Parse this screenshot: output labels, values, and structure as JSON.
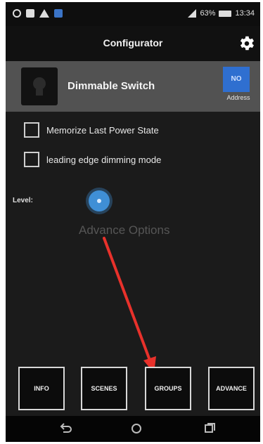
{
  "status_bar": {
    "battery": "63%",
    "time": "13:34",
    "icons": [
      "whatsapp-icon",
      "message-icon",
      "warning-icon",
      "store-icon",
      "signal-icon",
      "battery-icon"
    ]
  },
  "header": {
    "title": "Configurator",
    "settings_icon": "gear-icon"
  },
  "device": {
    "name": "Dimmable Switch",
    "address_badge": "NO",
    "address_label": "Address",
    "accent_color": "#2f6fd0"
  },
  "options": [
    {
      "label": "Memorize Last Power State",
      "checked": false
    },
    {
      "label": "leading edge dimming mode",
      "checked": false
    }
  ],
  "level": {
    "label": "Level:"
  },
  "advance_options": "Advance Options",
  "bottom_buttons": [
    "INFO",
    "SCENES",
    "GROUPS",
    "ADVANCE"
  ],
  "nav": [
    "back-icon",
    "home-icon",
    "recents-icon"
  ],
  "annotation_color": "#e8312b"
}
